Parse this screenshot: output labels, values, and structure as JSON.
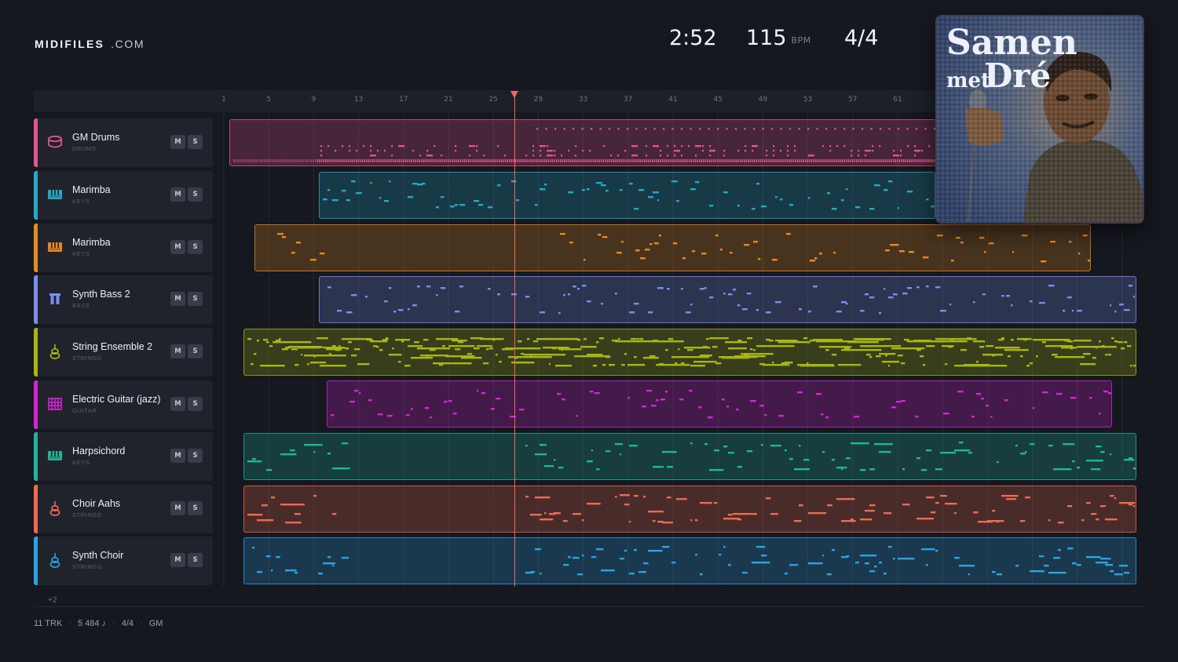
{
  "brand": {
    "name": "MIDIFILES",
    "domain": ".COM"
  },
  "hud": {
    "time": "2:52",
    "bpm": "115",
    "bpm_unit": "BPM",
    "time_signature": "4/4"
  },
  "cover": {
    "line1": "Samen",
    "line2a": "met",
    "line2b": "Dré"
  },
  "ruler": {
    "labels": [
      "1",
      "5",
      "9",
      "13",
      "17",
      "21",
      "25",
      "29",
      "33",
      "37",
      "41",
      "45",
      "49",
      "53",
      "57",
      "61"
    ]
  },
  "tracks": [
    {
      "name": "GM Drums",
      "category": "DRUMS",
      "color": "#e2558a",
      "icon": "drum-icon",
      "mute": "M",
      "solo": "S"
    },
    {
      "name": "Marimba",
      "category": "KEYS",
      "color": "#23a8c9",
      "icon": "keyboard-icon",
      "mute": "M",
      "solo": "S"
    },
    {
      "name": "Marimba",
      "category": "KEYS",
      "color": "#e8891e",
      "icon": "keyboard-icon",
      "mute": "M",
      "solo": "S"
    },
    {
      "name": "Synth Bass 2",
      "category": "BASS",
      "color": "#7a8ef0",
      "icon": "bass-icon",
      "mute": "M",
      "solo": "S"
    },
    {
      "name": "String Ensemble 2",
      "category": "STRINGS",
      "color": "#a7b515",
      "icon": "violin-icon",
      "mute": "M",
      "solo": "S"
    },
    {
      "name": "Electric Guitar (jazz)",
      "category": "GUITAR",
      "color": "#d623d6",
      "icon": "guitar-icon",
      "mute": "M",
      "solo": "S"
    },
    {
      "name": "Harpsichord",
      "category": "KEYS",
      "color": "#1fb59a",
      "icon": "keyboard-icon",
      "mute": "M",
      "solo": "S"
    },
    {
      "name": "Choir Aahs",
      "category": "STRINGS",
      "color": "#ef6a50",
      "icon": "violin-icon",
      "mute": "M",
      "solo": "S"
    },
    {
      "name": "Synth Choir",
      "category": "STRINGS",
      "color": "#2aa3e6",
      "icon": "violin-icon",
      "mute": "M",
      "solo": "S"
    }
  ],
  "more_tracks": "+2",
  "status": {
    "tracks": "11 TRK",
    "notes": "5 484 ♪",
    "time_signature": "4/4",
    "standard": "GM"
  }
}
